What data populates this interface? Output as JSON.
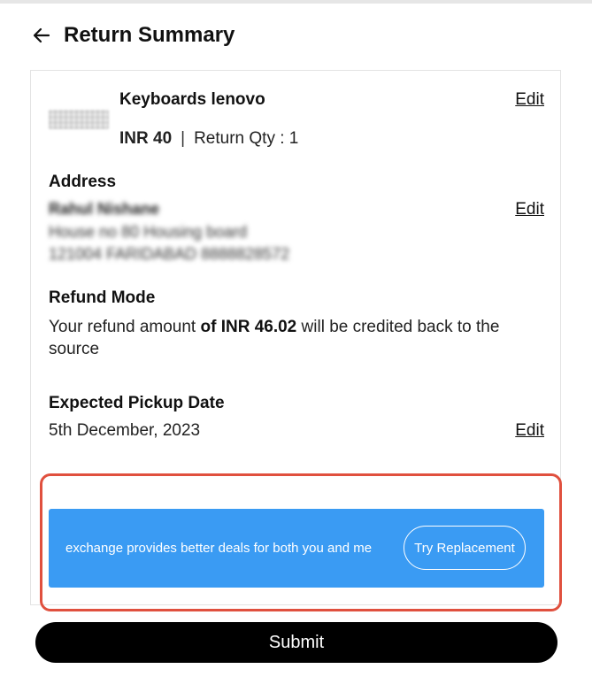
{
  "header": {
    "title": "Return Summary",
    "back_icon": "arrow-left-icon"
  },
  "product": {
    "name": "Keyboards lenovo",
    "price": "INR 40",
    "separator": "|",
    "return_qty": "Return Qty : 1",
    "edit_label": "Edit",
    "image_icon": "keyboard-thumbnail"
  },
  "address": {
    "label": "Address",
    "name": "Rahul Nishane",
    "line1": "House no 80 Housing board",
    "line2": "121004 FARIDABAD 8888828572",
    "edit_label": "Edit"
  },
  "refund": {
    "label": "Refund Mode",
    "text_prefix": "Your refund amount ",
    "amount": "of INR 46.02",
    "text_suffix": " will be credited back to the source"
  },
  "pickup": {
    "label": "Expected Pickup Date",
    "date": "5th December, 2023",
    "edit_label": "Edit"
  },
  "banner": {
    "text": "exchange provides better deals for both you and me",
    "button_label": "Try Replacement",
    "bg_color": "#3a9bf3",
    "highlight_color": "#e0503e"
  },
  "footer": {
    "submit_label": "Submit"
  }
}
